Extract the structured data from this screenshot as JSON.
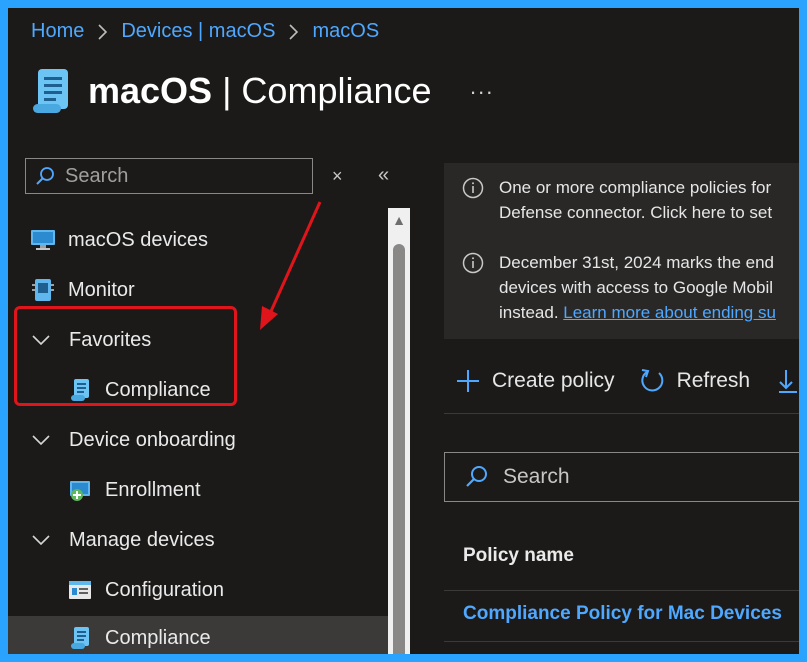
{
  "breadcrumb": {
    "items": [
      "Home",
      "Devices | macOS",
      "macOS"
    ]
  },
  "header": {
    "title_bold": "macOS",
    "title_rest": " | Compliance",
    "more": "..."
  },
  "sidebar": {
    "search_placeholder": "Search",
    "clear_symbol": "×",
    "collapse_symbol": "«",
    "items": [
      {
        "label": "macOS devices",
        "icon": "monitor-icon"
      },
      {
        "label": "Monitor",
        "icon": "monitor-device-icon"
      },
      {
        "label": "Favorites",
        "icon": "chevron-down-icon"
      },
      {
        "label": "Compliance",
        "icon": "compliance-scroll-icon"
      },
      {
        "label": "Device onboarding",
        "icon": "chevron-down-icon"
      },
      {
        "label": "Enrollment",
        "icon": "enrollment-icon"
      },
      {
        "label": "Manage devices",
        "icon": "chevron-down-icon"
      },
      {
        "label": "Configuration",
        "icon": "configuration-icon"
      },
      {
        "label": "Compliance",
        "icon": "compliance-scroll-icon"
      }
    ]
  },
  "info": {
    "banner1_line1": "One or more compliance policies for",
    "banner1_line2": "Defense connector. Click here to set",
    "banner2_line1": "December 31st, 2024 marks the end",
    "banner2_line2": "devices with access to Google Mobil",
    "banner2_line3_text": "instead. ",
    "banner2_link": "Learn more about ending su"
  },
  "toolbar": {
    "create_label": "Create policy",
    "refresh_label": "Refresh"
  },
  "table": {
    "search_placeholder": "Search",
    "column_policy_name": "Policy name",
    "rows": [
      "Compliance Policy for Mac Devices"
    ]
  },
  "colors": {
    "frame_border": "#2aa3ff",
    "background": "#1b1a19",
    "link": "#4fa8ff",
    "highlight": "#e0151b",
    "selected_row": "#3b3a39"
  }
}
